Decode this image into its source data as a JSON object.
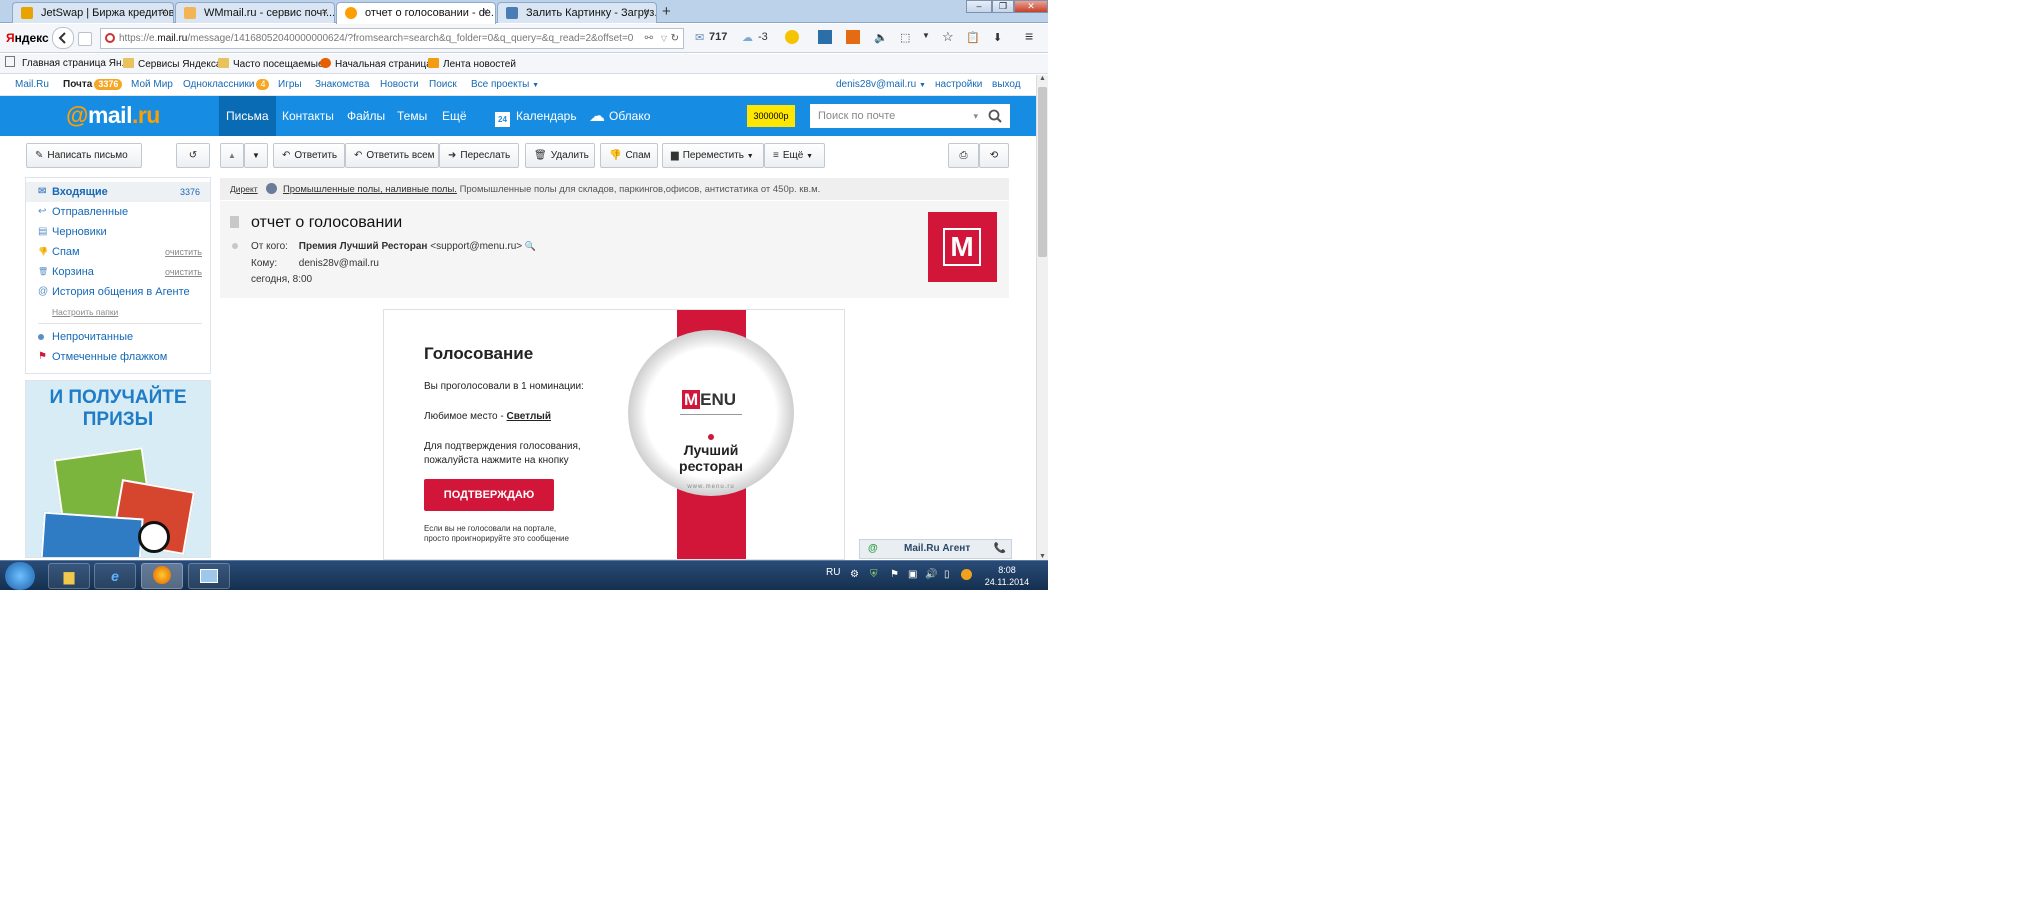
{
  "browser": {
    "tabs": [
      {
        "title": "JetSwap | Биржа кредитов",
        "icon_color": "#e7a400"
      },
      {
        "title": "WMmail.ru - сервис почт...",
        "icon_color": "#f3b553"
      },
      {
        "title": "отчет о голосовании - de...",
        "icon_color": "#ff9e00"
      },
      {
        "title": "Залить Картинку - Загруз...",
        "icon_color": "#4b7db5"
      }
    ],
    "close_glyph": "×",
    "new_tab": "+",
    "window_controls": [
      "‒",
      "❐",
      "✕"
    ],
    "brand": {
      "first": "Я",
      "rest": "ндекс"
    },
    "url_host_prefix": "https://e.",
    "url_host": "mail.ru",
    "url_rest": "/message/14168052040000000624/?fromsearch=search&q_folder=0&q_query=&q_read=2&offset=0",
    "mail_count": "717",
    "weather": "-3",
    "bookmarks": [
      "Главная страница Ян...",
      "Сервисы Яндекса",
      "Часто посещаемые",
      "Начальная страница",
      "Лента новостей"
    ]
  },
  "portal": {
    "links": [
      "Mail.Ru",
      "Почта",
      "Мой Мир",
      "Одноклассники",
      "Игры",
      "Знакомства",
      "Новости",
      "Поиск",
      "Все проекты"
    ],
    "mail_badge": "3376",
    "ok_badge": "4",
    "user": "denis28v@mail.ru",
    "settings": "настройки",
    "logout": "выход"
  },
  "header": {
    "logo_at": "@",
    "logo_mail": "mail",
    "logo_ru": ".ru",
    "nav": [
      "Письма",
      "Контакты",
      "Файлы",
      "Темы",
      "Ещё"
    ],
    "calendar": "Календарь",
    "calendar_day": "24",
    "cloud": "Облако",
    "prize": "300000р",
    "search_placeholder": "Поиск по почте"
  },
  "toolbar": {
    "compose": "Написать письмо",
    "reply": "Ответить",
    "reply_all": "Ответить всем",
    "forward": "Переслать",
    "delete": "Удалить",
    "spam": "Спам",
    "move": "Переместить",
    "more": "Ещё"
  },
  "sidebar": {
    "folders": [
      {
        "label": "Входящие",
        "count": "3376",
        "icon": "inbox-icon",
        "glyph": "✉"
      },
      {
        "label": "Отправленные",
        "icon": "sent-icon",
        "glyph": "↩"
      },
      {
        "label": "Черновики",
        "icon": "drafts-icon",
        "glyph": "▤"
      },
      {
        "label": "Спам",
        "action": "очистить",
        "icon": "spam-icon",
        "glyph": "👎"
      },
      {
        "label": "Корзина",
        "action": "очистить",
        "icon": "trash-icon",
        "glyph": "🗑"
      },
      {
        "label": "История общения в Агенте",
        "icon": "agent-icon",
        "glyph": "@"
      }
    ],
    "configure": "Настроить папки",
    "unread": "Непрочитанные",
    "flagged": "Отмеченные флажком"
  },
  "ad": {
    "line1": "И ПОЛУЧАЙТЕ",
    "line2": "ПРИЗЫ"
  },
  "direct": {
    "label": "Директ",
    "link": "Промышленные полы, наливные полы.",
    "text": "Промышленные полы для складов, паркингов,офисов, антистатика от 450р. кв.м."
  },
  "message": {
    "subject": "отчет о голосовании",
    "from_label": "От кого:",
    "from_name": "Премия Лучший Ресторан",
    "from_email": "<support@menu.ru>",
    "to_label": "Кому:",
    "to": "denis28v@mail.ru",
    "date": "сегодня, 8:00",
    "avatar_letter": "M"
  },
  "email_body": {
    "title": "Голосование",
    "voted": "Вы проголосовали в 1 номинации:",
    "favorite_label": "Любимое место -",
    "favorite_value": "Светлый",
    "confirm_line1": "Для подтверждения голосования,",
    "confirm_line2": "пожалуйста нажмите на кнопку",
    "button": "ПОДТВЕРЖДАЮ",
    "note_line1": "Если вы не голосовали на портале,",
    "note_line2": "просто проигнорируйте это сообщение",
    "plate_logo_m": "M",
    "plate_logo_rest": "ENU",
    "plate_line1": "Лучший",
    "plate_line2": "ресторан",
    "plate_url": "www.menu.ru"
  },
  "agent": {
    "label": "Mail.Ru Агент"
  },
  "taskbar": {
    "lang": "RU",
    "time": "8:08",
    "date": "24.11.2014"
  },
  "colors": {
    "mailru_blue": "#168de2",
    "accent_red": "#d2163a",
    "link_blue": "#1569b6"
  }
}
